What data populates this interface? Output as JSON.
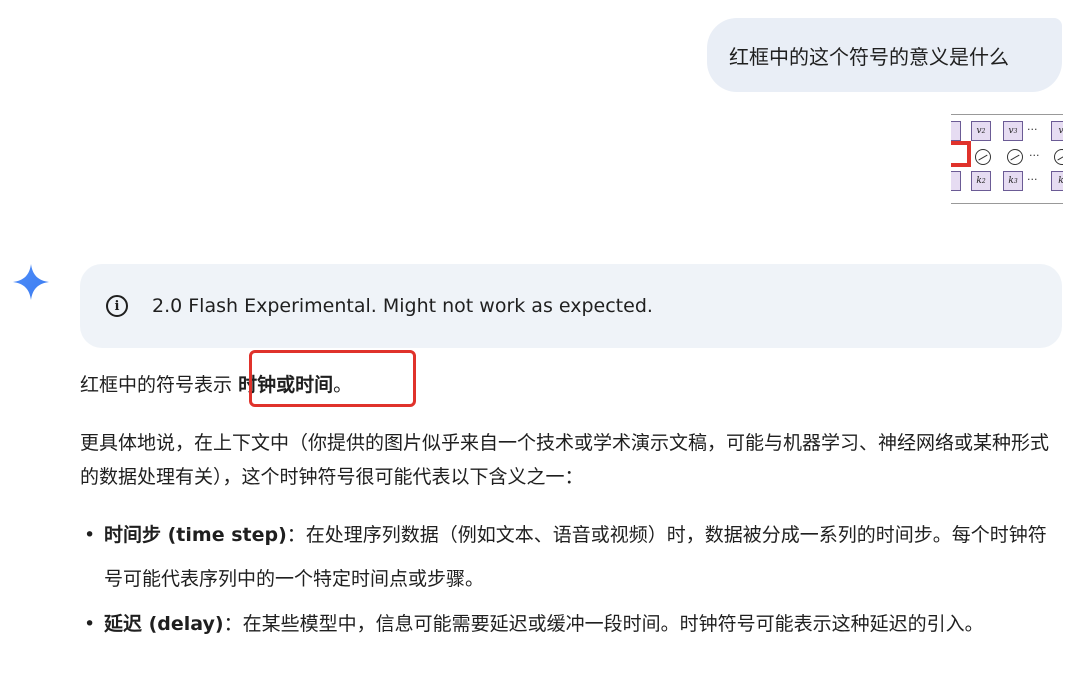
{
  "user_message": "红框中的这个符号的意义是什么",
  "thumbnail": {
    "labels_top": [
      "v",
      "v",
      "v"
    ],
    "labels_bottom": [
      "k",
      "k",
      "k"
    ],
    "ellipsis": "···"
  },
  "notice": {
    "icon": "info-icon",
    "text": "2.0 Flash Experimental. Might not work as expected."
  },
  "answer": {
    "line1_prefix": "红框中的符号表示",
    "line1_bold": "时钟或时间",
    "line1_suffix": "。",
    "para2": "更具体地说，在上下文中（你提供的图片似乎来自一个技术或学术演示文稿，可能与机器学习、神经网络或某种形式的数据处理有关），这个时钟符号很可能代表以下含义之一：",
    "bullets": [
      {
        "bold": "时间步 (time step)",
        "text": "：在处理序列数据（例如文本、语音或视频）时，数据被分成一系列的时间步。每个时钟符号可能代表序列中的一个特定时间点或步骤。"
      },
      {
        "bold": "延迟 (delay)",
        "text": "：在某些模型中，信息可能需要延迟或缓冲一段时间。时钟符号可能表示这种延迟的引入。"
      }
    ]
  },
  "colors": {
    "user_bubble": "#e9eef6",
    "notice_bg": "#eff3f8",
    "highlight_red": "#e0322b",
    "gemini_blue": "#4285f4"
  }
}
